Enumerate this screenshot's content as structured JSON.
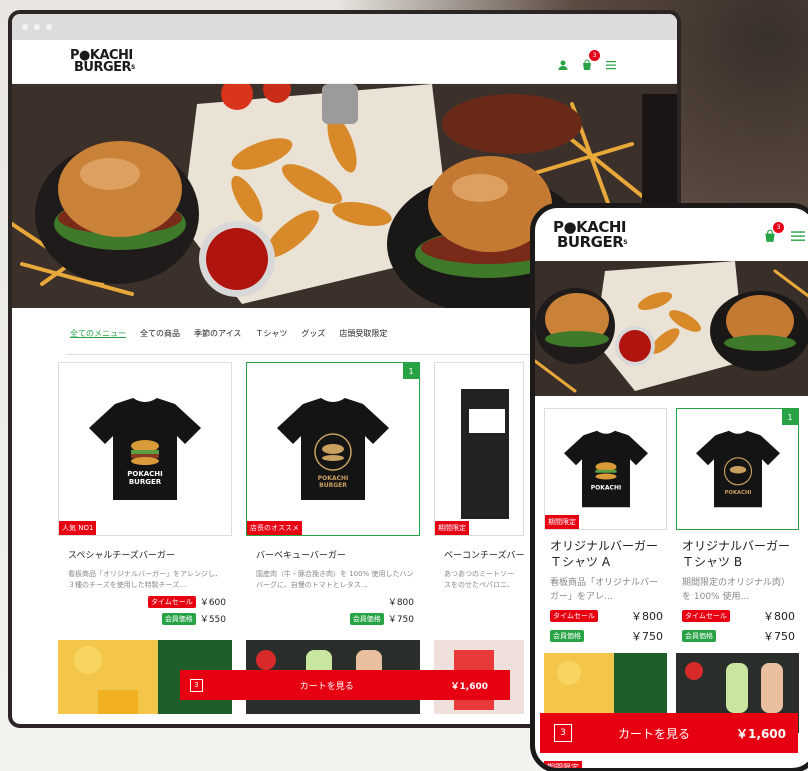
{
  "brand": {
    "logo_line1": "P●KACHI",
    "logo_line2": "BURGER",
    "logo_suffix": "S"
  },
  "header": {
    "cart_count": "3"
  },
  "tabs": [
    "全てのメニュー",
    "全ての商品",
    "季節のアイス",
    "Ｔシャツ",
    "グッズ",
    "店頭受取限定"
  ],
  "desktop_products": [
    {
      "title": "スペシャルチーズバーガー",
      "desc": "看板商品「オリジナルバーガー」をアレンジし、３種のチーズを使用した特製チーズ…",
      "tag": "人気 NO1",
      "sale_label": "タイムセール",
      "sale_price": "￥600",
      "member_label": "会員価格",
      "member_price": "￥550",
      "selected": false,
      "num": ""
    },
    {
      "title": "バーベキューバーガー",
      "desc": "国産肉（牛・豚合挽き肉）を 100% 使用したハンバーグに、自慢のトマトとレタス…",
      "tag": "店長のオススメ",
      "price": "￥800",
      "member_label": "会員価格",
      "member_price": "￥750",
      "selected": true,
      "num": "1"
    },
    {
      "title": "ベーコンチーズバーガー",
      "desc": "あつあつのミートソースをのせたペパロニ、ラペーニョとスライス…",
      "tag": "期間限定"
    }
  ],
  "cart": {
    "count": "3",
    "label": "カートを見る",
    "total": "￥1,600"
  },
  "phone": {
    "products": [
      {
        "title": "オリジナルバーガー Ｔシャツ A",
        "desc": "看板商品「オリジナルバーガー」をアレ…",
        "tag": "期間限定",
        "sale_label": "タイムセール",
        "sale_price": "￥800",
        "member_label": "会員価格",
        "member_price": "￥750"
      },
      {
        "title": "オリジナルバーガー Ｔシャツ B",
        "desc": "期間限定のオリジナル肉）を 100% 使用…",
        "num": "1",
        "sale_label": "タイムセール",
        "sale_price": "￥800",
        "member_label": "会員価格",
        "member_price": "￥750"
      }
    ],
    "bottom_tag": "期間限定",
    "cart_count": "3",
    "cart_label": "カートを見る",
    "cart_total": "￥1,600"
  },
  "colors": {
    "accent": "#27a345",
    "red": "#e60012"
  }
}
